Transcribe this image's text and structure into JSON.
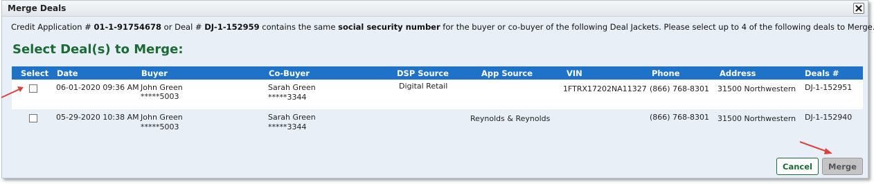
{
  "dialog": {
    "title": "Merge Deals",
    "close_icon": "close-icon"
  },
  "info": {
    "part1": "Credit Application # ",
    "credit_app": "01-1-91754678",
    "part2": " or Deal # ",
    "deal_no": "DJ-1-152959",
    "part3": " contains the same ",
    "ssn_phrase": "social security number",
    "part4": " for the buyer or co-buyer of the following Deal Jackets. Please select up to 4 of the following deals to Merge."
  },
  "heading": "Select Deal(s) to Merge:",
  "table": {
    "headers": {
      "select": "Select",
      "date": "Date",
      "buyer": "Buyer",
      "cobuyer": "Co-Buyer",
      "dsp": "DSP Source",
      "app": "App Source",
      "vin": "VIN",
      "phone": "Phone",
      "address": "Address",
      "deals": "Deals #"
    },
    "rows": [
      {
        "checked": false,
        "date": "06-01-2020 09:36 AM",
        "buyer_name": "John Green",
        "buyer_ssn": "*****5003",
        "cobuyer_name": "Sarah  Green",
        "cobuyer_ssn": "*****3344",
        "dsp": "Digital Retail",
        "app": "",
        "vin": "1FTRX17202NA11327",
        "phone": "(866) 768-8301",
        "address": "31500 Northwestern",
        "deal": "DJ-1-152951"
      },
      {
        "checked": false,
        "date": "05-29-2020 10:38 AM",
        "buyer_name": "John Green",
        "buyer_ssn": "*****5003",
        "cobuyer_name": "Sarah  Green",
        "cobuyer_ssn": "*****3344",
        "dsp": "",
        "app": "Reynolds & Reynolds",
        "vin": "",
        "phone": "(866) 768-8301",
        "address": "31500 Northwestern",
        "deal": "DJ-1-152940"
      }
    ]
  },
  "buttons": {
    "cancel": "Cancel",
    "merge": "Merge"
  },
  "colors": {
    "header_bg": "#1e73c8",
    "heading": "#1a6b35",
    "annotation_arrow": "#e0403a"
  }
}
